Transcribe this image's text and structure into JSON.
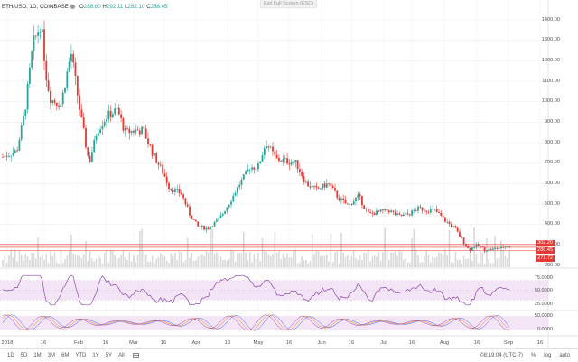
{
  "header": {
    "symbol": "ETH/USD, 1D, COINBASE",
    "open_label": "O",
    "open": "288.60",
    "high_label": "H",
    "high": "292.11",
    "low_label": "L",
    "low": "282.10",
    "close_label": "C",
    "close": "288.45",
    "fullscreen_hint": "Exit Full Screen (ESC)"
  },
  "price_tags": {
    "upper": "302.20",
    "current": "288.45",
    "lower": "271.72"
  },
  "indicator_labels": {
    "rsi_top": "75.0000",
    "rsi_mid": "50.0000",
    "rsi_low": "25.0000",
    "stoch_top": "50.0000",
    "stoch_low": "0.0000"
  },
  "x_axis": [
    "2018",
    "16",
    "Feb",
    "16",
    "Mar",
    "16",
    "Apr",
    "16",
    "May",
    "16",
    "Jun",
    "16",
    "Jul",
    "16",
    "Aug",
    "16",
    "Sep",
    "16"
  ],
  "bottom_bar": {
    "ranges": [
      "1D",
      "5D",
      "1M",
      "3M",
      "6M",
      "YTD",
      "1Y",
      "5Y",
      "All"
    ],
    "time": "08:19:04 (UTC-7)",
    "percent": "%",
    "log": "log",
    "auto": "auto"
  },
  "colors": {
    "up": "#26a69a",
    "down": "#e53935",
    "rsi": "#8e44ad",
    "band": "#f3e5f5",
    "volume": "#cfcfcf"
  },
  "chart_data": {
    "type": "candlestick",
    "title": "ETH/USD, 1D, COINBASE",
    "xlabel": "",
    "ylabel": "",
    "ylim": [
      200,
      1450
    ],
    "y_ticks": [
      200,
      300,
      400,
      500,
      600,
      700,
      800,
      900,
      1000,
      1100,
      1200,
      1300,
      1400
    ],
    "grid": true,
    "keypoints": [
      {
        "date": "2017-12-25",
        "close": 730
      },
      {
        "date": "2018-01-01",
        "close": 760
      },
      {
        "date": "2018-01-05",
        "close": 950
      },
      {
        "date": "2018-01-09",
        "close": 1280
      },
      {
        "date": "2018-01-13",
        "close": 1380
      },
      {
        "date": "2018-01-16",
        "close": 1100
      },
      {
        "date": "2018-01-18",
        "close": 1010
      },
      {
        "date": "2018-01-23",
        "close": 990
      },
      {
        "date": "2018-01-28",
        "close": 1240
      },
      {
        "date": "2018-02-02",
        "close": 920
      },
      {
        "date": "2018-02-06",
        "close": 700
      },
      {
        "date": "2018-02-10",
        "close": 860
      },
      {
        "date": "2018-02-15",
        "close": 930
      },
      {
        "date": "2018-02-20",
        "close": 960
      },
      {
        "date": "2018-02-24",
        "close": 850
      },
      {
        "date": "2018-03-01",
        "close": 860
      },
      {
        "date": "2018-03-05",
        "close": 860
      },
      {
        "date": "2018-03-10",
        "close": 740
      },
      {
        "date": "2018-03-15",
        "close": 650
      },
      {
        "date": "2018-03-18",
        "close": 580
      },
      {
        "date": "2018-03-24",
        "close": 550
      },
      {
        "date": "2018-03-28",
        "close": 450
      },
      {
        "date": "2018-04-01",
        "close": 390
      },
      {
        "date": "2018-04-06",
        "close": 380
      },
      {
        "date": "2018-04-12",
        "close": 430
      },
      {
        "date": "2018-04-17",
        "close": 510
      },
      {
        "date": "2018-04-22",
        "close": 600
      },
      {
        "date": "2018-04-27",
        "close": 680
      },
      {
        "date": "2018-05-01",
        "close": 680
      },
      {
        "date": "2018-05-05",
        "close": 800
      },
      {
        "date": "2018-05-10",
        "close": 720
      },
      {
        "date": "2018-05-15",
        "close": 710
      },
      {
        "date": "2018-05-20",
        "close": 700
      },
      {
        "date": "2018-05-25",
        "close": 600
      },
      {
        "date": "2018-05-30",
        "close": 570
      },
      {
        "date": "2018-06-05",
        "close": 600
      },
      {
        "date": "2018-06-10",
        "close": 530
      },
      {
        "date": "2018-06-15",
        "close": 490
      },
      {
        "date": "2018-06-20",
        "close": 540
      },
      {
        "date": "2018-06-25",
        "close": 450
      },
      {
        "date": "2018-06-30",
        "close": 460
      },
      {
        "date": "2018-07-05",
        "close": 470
      },
      {
        "date": "2018-07-10",
        "close": 440
      },
      {
        "date": "2018-07-15",
        "close": 450
      },
      {
        "date": "2018-07-20",
        "close": 480
      },
      {
        "date": "2018-07-24",
        "close": 470
      },
      {
        "date": "2018-07-28",
        "close": 470
      },
      {
        "date": "2018-08-02",
        "close": 420
      },
      {
        "date": "2018-08-07",
        "close": 380
      },
      {
        "date": "2018-08-11",
        "close": 320
      },
      {
        "date": "2018-08-14",
        "close": 275
      },
      {
        "date": "2018-08-18",
        "close": 300
      },
      {
        "date": "2018-08-22",
        "close": 275
      },
      {
        "date": "2018-08-26",
        "close": 280
      },
      {
        "date": "2018-08-30",
        "close": 285
      },
      {
        "date": "2018-09-02",
        "close": 295
      },
      {
        "date": "2018-09-04",
        "close": 288.45
      }
    ]
  }
}
